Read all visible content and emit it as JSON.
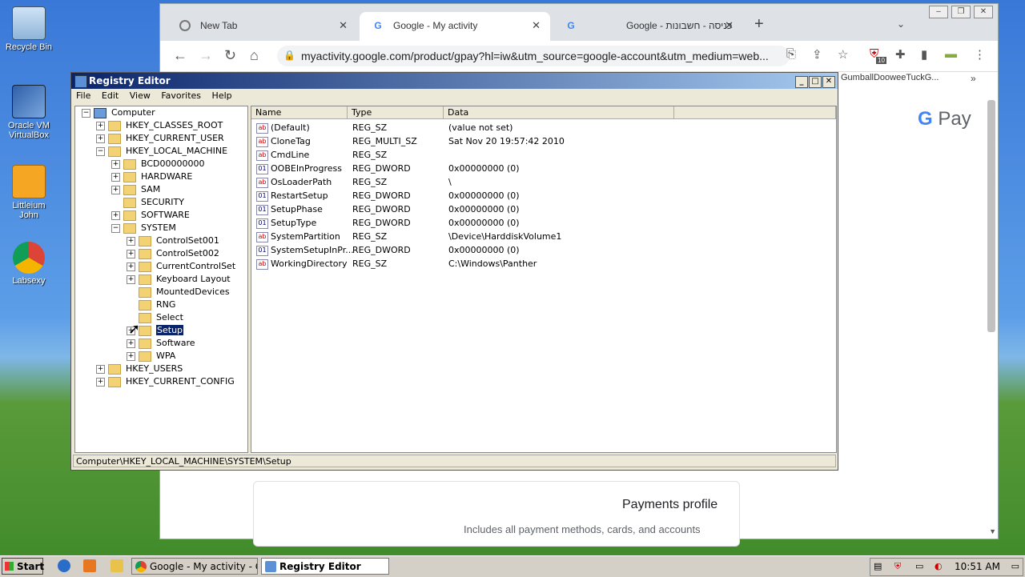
{
  "desktop": {
    "icons": [
      {
        "label": "Recycle Bin"
      },
      {
        "label": "Oracle VM VirtualBox"
      },
      {
        "label": "Littleium John"
      },
      {
        "label": "Labsexy"
      }
    ]
  },
  "browser": {
    "tabs": [
      {
        "label": "New Tab"
      },
      {
        "label": "Google - My activity"
      },
      {
        "label": "Google - כניסה - חשבונות"
      }
    ],
    "new_tab_symbol": "+",
    "url": "myactivity.google.com/product/gpay?hl=iw&utm_source=google-account&utm_medium=web...",
    "bookmark_visible": "GumballDooweeTuckG...",
    "extension_badge": "10",
    "gpay_logo": {
      "g": "G",
      "text": "Pay"
    },
    "payments_card": {
      "title": "Payments profile",
      "subtitle": "Includes all payment methods, cards, and accounts"
    }
  },
  "regedit": {
    "title": "Registry Editor",
    "menu": [
      "File",
      "Edit",
      "View",
      "Favorites",
      "Help"
    ],
    "tree": {
      "root": "Computer",
      "hives": [
        "HKEY_CLASSES_ROOT",
        "HKEY_CURRENT_USER",
        "HKEY_LOCAL_MACHINE"
      ],
      "hklm_children": [
        "BCD00000000",
        "HARDWARE",
        "SAM",
        "SECURITY",
        "SOFTWARE",
        "SYSTEM"
      ],
      "system_children": [
        "ControlSet001",
        "ControlSet002",
        "CurrentControlSet",
        "Keyboard Layout",
        "MountedDevices",
        "RNG",
        "Select",
        "Setup",
        "Software",
        "WPA"
      ],
      "other_hives": [
        "HKEY_USERS",
        "HKEY_CURRENT_CONFIG"
      ],
      "selected": "Setup"
    },
    "columns": [
      "Name",
      "Type",
      "Data"
    ],
    "values": [
      {
        "name": "(Default)",
        "type": "REG_SZ",
        "data": "(value not set)",
        "icon": "string-icon"
      },
      {
        "name": "CloneTag",
        "type": "REG_MULTI_SZ",
        "data": "Sat Nov 20 19:57:42 2010",
        "icon": "string-icon"
      },
      {
        "name": "CmdLine",
        "type": "REG_SZ",
        "data": "",
        "icon": "string-icon"
      },
      {
        "name": "OOBEInProgress",
        "type": "REG_DWORD",
        "data": "0x00000000 (0)",
        "icon": "binary-icon"
      },
      {
        "name": "OsLoaderPath",
        "type": "REG_SZ",
        "data": "\\",
        "icon": "string-icon"
      },
      {
        "name": "RestartSetup",
        "type": "REG_DWORD",
        "data": "0x00000000 (0)",
        "icon": "binary-icon"
      },
      {
        "name": "SetupPhase",
        "type": "REG_DWORD",
        "data": "0x00000000 (0)",
        "icon": "binary-icon"
      },
      {
        "name": "SetupType",
        "type": "REG_DWORD",
        "data": "0x00000000 (0)",
        "icon": "binary-icon"
      },
      {
        "name": "SystemPartition",
        "type": "REG_SZ",
        "data": "\\Device\\HarddiskVolume1",
        "icon": "string-icon"
      },
      {
        "name": "SystemSetupInPr...",
        "type": "REG_DWORD",
        "data": "0x00000000 (0)",
        "icon": "binary-icon"
      },
      {
        "name": "WorkingDirectory",
        "type": "REG_SZ",
        "data": "C:\\Windows\\Panther",
        "icon": "string-icon"
      }
    ],
    "status_path": "Computer\\HKEY_LOCAL_MACHINE\\SYSTEM\\Setup"
  },
  "taskbar": {
    "start_label": "Start",
    "tasks": [
      {
        "label": "Google - My activity - Go...",
        "active": false
      },
      {
        "label": "Registry Editor",
        "active": true
      }
    ],
    "clock": "10:51 AM"
  }
}
